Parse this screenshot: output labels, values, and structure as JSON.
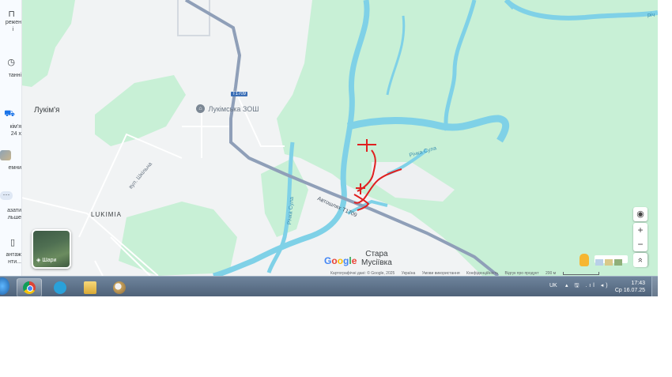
{
  "sidebar": {
    "items": [
      {
        "icon": "bookmark-icon",
        "label_1": "режен",
        "label_2": "і"
      },
      {
        "icon": "history-icon",
        "label_1": "танні",
        "label_2": ""
      },
      {
        "icon": "car-icon",
        "label_1": "кім'я",
        "label_2": "24 х"
      },
      {
        "icon": "place-thumbnail",
        "label_1": "емни",
        "label_2": ""
      },
      {
        "icon": "more-icon",
        "label_1": "азати",
        "label_2": "льше"
      },
      {
        "icon": "download-icon",
        "label_1": "антаж",
        "label_2": "нти..."
      }
    ]
  },
  "map": {
    "labels": {
      "village_lukimia": "Лукім'я",
      "village_lukimia_latin": "LUKIMIA",
      "school": "Лукімська ЗОШ",
      "road_badge": "Т1709",
      "road_name": "Автошлях Т1709",
      "street": "вул. Шкільна",
      "river_sula": "Річка Сула",
      "river_side": "Річка Сула",
      "stara_1": "Стара",
      "stara_2": "Мусіївка",
      "river_top_right": "річ"
    },
    "layers_label": "Шари",
    "controls": {
      "locate_icon": "my-location-icon",
      "zoom_in": "+",
      "zoom_out": "−",
      "expand": "»"
    },
    "attribution": {
      "data": "Картографічні дані: © Google, 2025",
      "country": "Україна",
      "terms": "Умови використання",
      "privacy": "Конфіденційність",
      "feedback": "Відгук про продукт",
      "scale": "200 м"
    },
    "google_logo": "Google",
    "colors": {
      "land": "#f1f3f4",
      "forest": "#c8f0d6",
      "water": "#7fd1e7",
      "road": "#8f9fb8",
      "annotation": "#e02020"
    }
  },
  "taskbar": {
    "apps": [
      "chrome-icon",
      "telegram-icon",
      "file-explorer-icon",
      "paint-icon"
    ],
    "lang": "UK",
    "tray_icons": "▴ 🖫 .ıl ◂)",
    "time": "17:43",
    "date": "Ср 16.07.25"
  }
}
